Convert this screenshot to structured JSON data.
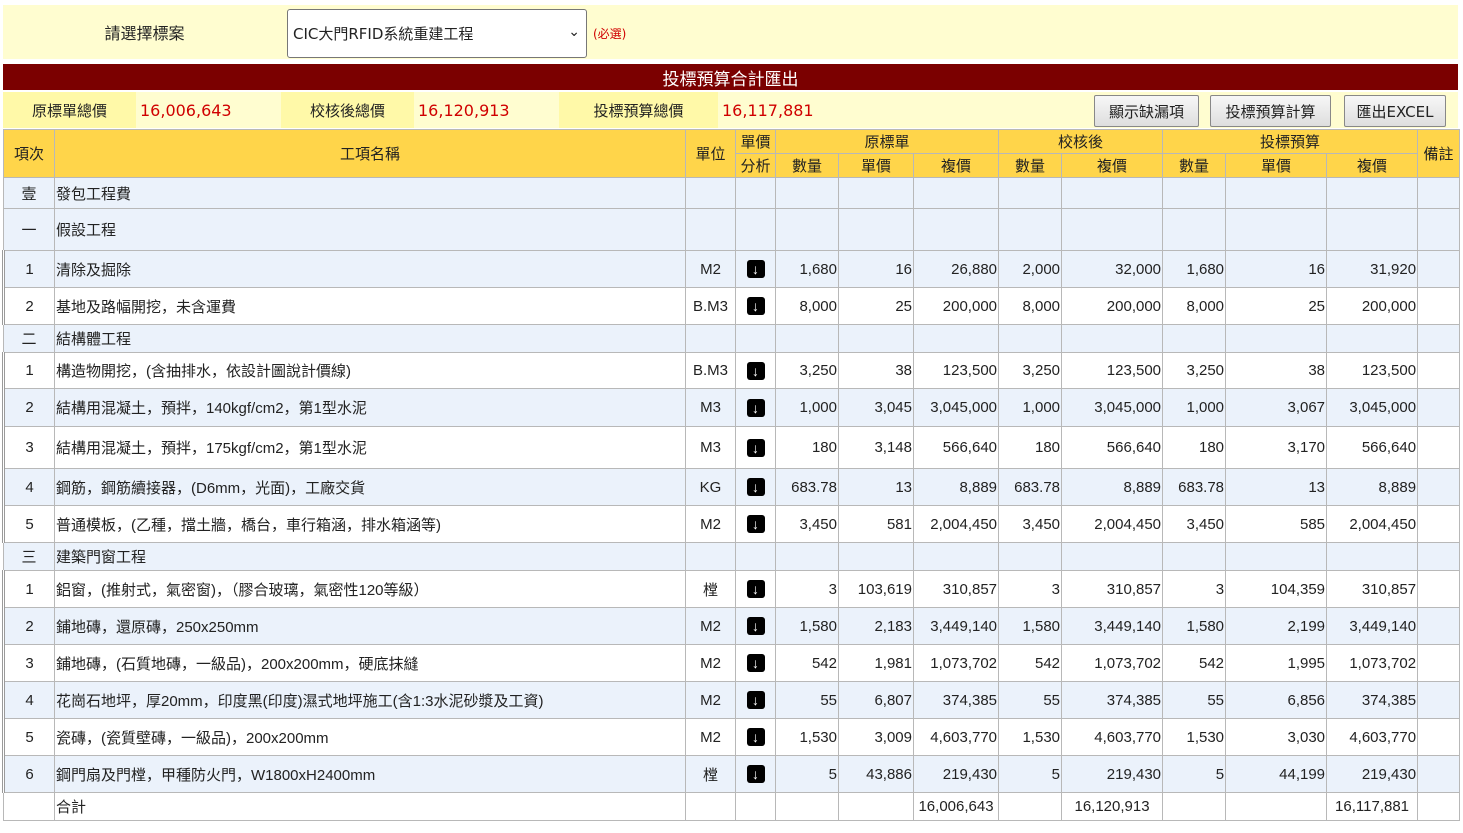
{
  "selector": {
    "label": "請選擇標案",
    "value": "CIC大門RFID系統重建工程",
    "required": "(必選)"
  },
  "title": "投標預算合計匯出",
  "totals": {
    "orig_label": "原標單總價",
    "orig_value": "16,006,643",
    "checked_label": "校核後總價",
    "checked_value": "16,120,913",
    "bid_label": "投標預算總價",
    "bid_value": "16,117,881"
  },
  "buttons": {
    "show_missing": "顯示缺漏項",
    "calc_budget": "投標預算計算",
    "export_excel": "匯出EXCEL"
  },
  "headers": {
    "item": "項次",
    "name": "工項名稱",
    "unit": "單位",
    "analysis_1": "單價",
    "analysis_2": "分析",
    "orig_group": "原標單",
    "checked_group": "校核後",
    "bid_group": "投標預算",
    "qty": "數量",
    "price": "單價",
    "amount": "複價",
    "remark": "備註"
  },
  "rows": [
    {
      "type": "grp",
      "item": "壹",
      "name": "發包工程費"
    },
    {
      "type": "grp2",
      "item": "一",
      "name": "假設工程"
    },
    {
      "type": "row",
      "item": "1",
      "name": "清除及掘除",
      "unit": "M2",
      "oq": "1,680",
      "op": "16",
      "oa": "26,880",
      "cq": "2,000",
      "ca": "32,000",
      "bq": "1,680",
      "bp": "16",
      "ba": "31,920"
    },
    {
      "type": "row",
      "item": "2",
      "name": "基地及路幅開挖，未含運費",
      "unit": "B.M3",
      "oq": "8,000",
      "op": "25",
      "oa": "200,000",
      "cq": "8,000",
      "ca": "200,000",
      "bq": "8,000",
      "bp": "25",
      "ba": "200,000"
    },
    {
      "type": "grp",
      "item": "二",
      "name": "結構體工程"
    },
    {
      "type": "row",
      "item": "1",
      "name": "構造物開挖，(含抽排水，依設計圖說計價線)",
      "unit": "B.M3",
      "oq": "3,250",
      "op": "38",
      "oa": "123,500",
      "cq": "3,250",
      "ca": "123,500",
      "bq": "3,250",
      "bp": "38",
      "ba": "123,500"
    },
    {
      "type": "row",
      "item": "2",
      "name": "結構用混凝土，預拌，140kgf/cm2，第1型水泥",
      "unit": "M3",
      "oq": "1,000",
      "op": "3,045",
      "oa": "3,045,000",
      "cq": "1,000",
      "ca": "3,045,000",
      "bq": "1,000",
      "bp": "3,067",
      "ba": "3,045,000"
    },
    {
      "type": "row",
      "item": "3",
      "name": "結構用混凝土，預拌，175kgf/cm2，第1型水泥",
      "unit": "M3",
      "oq": "180",
      "op": "3,148",
      "oa": "566,640",
      "cq": "180",
      "ca": "566,640",
      "bq": "180",
      "bp": "3,170",
      "ba": "566,640"
    },
    {
      "type": "row",
      "item": "4",
      "name": "鋼筋，鋼筋續接器，(D6mm，光面)，工廠交貨",
      "unit": "KG",
      "oq": "683.78",
      "op": "13",
      "oa": "8,889",
      "cq": "683.78",
      "ca": "8,889",
      "bq": "683.78",
      "bp": "13",
      "ba": "8,889"
    },
    {
      "type": "row",
      "item": "5",
      "name": "普通模板，(乙種，擋土牆，橋台，車行箱涵，排水箱涵等)",
      "unit": "M2",
      "oq": "3,450",
      "op": "581",
      "oa": "2,004,450",
      "cq": "3,450",
      "ca": "2,004,450",
      "bq": "3,450",
      "bp": "585",
      "ba": "2,004,450"
    },
    {
      "type": "grp",
      "item": "三",
      "name": "建築門窗工程"
    },
    {
      "type": "row",
      "item": "1",
      "name": "鋁窗，(推射式，氣密窗)，（膠合玻璃，氣密性120等級）",
      "unit": "樘",
      "oq": "3",
      "op": "103,619",
      "oa": "310,857",
      "cq": "3",
      "ca": "310,857",
      "bq": "3",
      "bp": "104,359",
      "ba": "310,857"
    },
    {
      "type": "row",
      "item": "2",
      "name": "鋪地磚，還原磚，250x250mm",
      "unit": "M2",
      "oq": "1,580",
      "op": "2,183",
      "oa": "3,449,140",
      "cq": "1,580",
      "ca": "3,449,140",
      "bq": "1,580",
      "bp": "2,199",
      "ba": "3,449,140"
    },
    {
      "type": "row",
      "item": "3",
      "name": "鋪地磚，(石質地磚，一級品)，200x200mm，硬底抹縫",
      "unit": "M2",
      "oq": "542",
      "op": "1,981",
      "oa": "1,073,702",
      "cq": "542",
      "ca": "1,073,702",
      "bq": "542",
      "bp": "1,995",
      "ba": "1,073,702"
    },
    {
      "type": "row",
      "item": "4",
      "name": "花崗石地坪，厚20mm，印度黑(印度)濕式地坪施工(含1:3水泥砂漿及工資)",
      "unit": "M2",
      "oq": "55",
      "op": "6,807",
      "oa": "374,385",
      "cq": "55",
      "ca": "374,385",
      "bq": "55",
      "bp": "6,856",
      "ba": "374,385"
    },
    {
      "type": "row",
      "item": "5",
      "name": "瓷磚，(瓷質壁磚，一級品)，200x200mm",
      "unit": "M2",
      "oq": "1,530",
      "op": "3,009",
      "oa": "4,603,770",
      "cq": "1,530",
      "ca": "4,603,770",
      "bq": "1,530",
      "bp": "3,030",
      "ba": "4,603,770"
    },
    {
      "type": "row",
      "item": "6",
      "name": "鋼門扇及門樘，甲種防火門，W1800xH2400mm",
      "unit": "樘",
      "oq": "5",
      "op": "43,886",
      "oa": "219,430",
      "cq": "5",
      "ca": "219,430",
      "bq": "5",
      "bp": "44,199",
      "ba": "219,430"
    },
    {
      "type": "total",
      "name": "合計",
      "oa": "16,006,643",
      "ca": "16,120,913",
      "ba": "16,117,881"
    }
  ]
}
